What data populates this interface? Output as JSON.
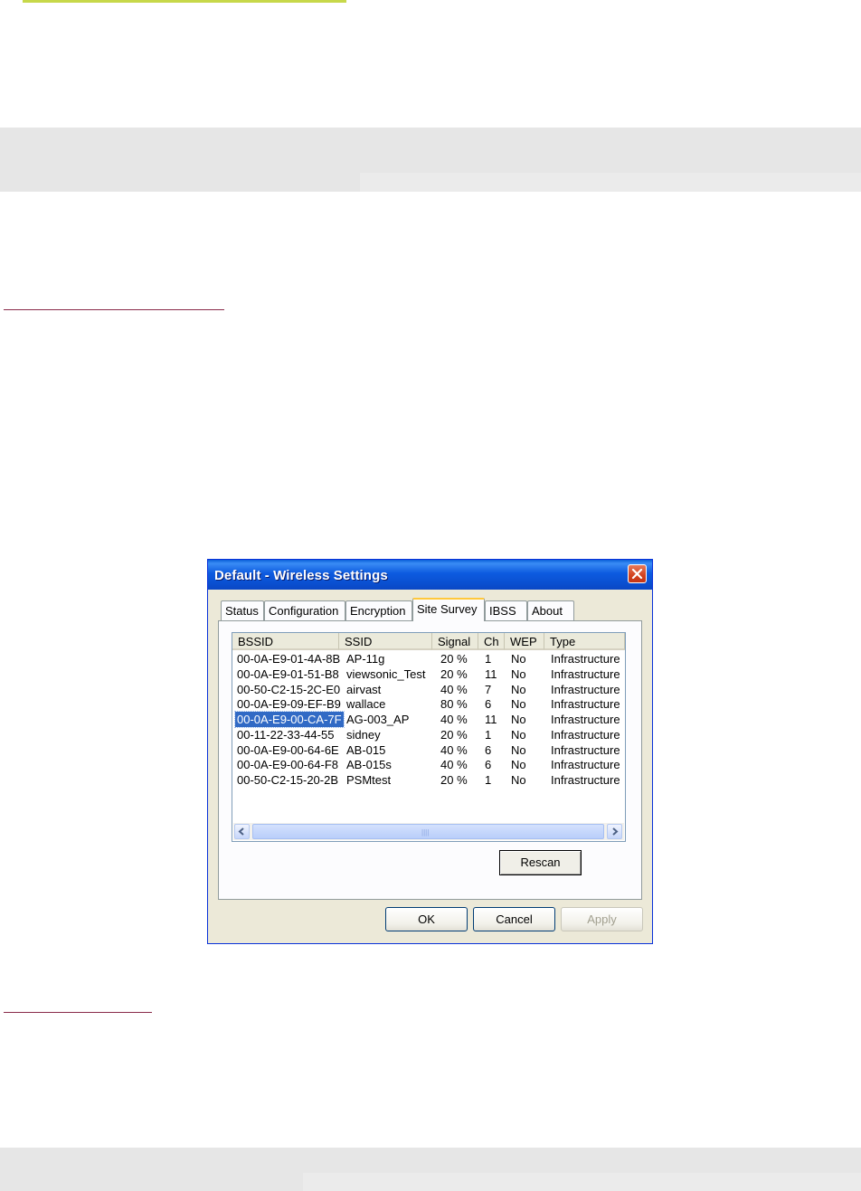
{
  "window": {
    "title": "Default - Wireless Settings"
  },
  "tabs": [
    "Status",
    "Configuration",
    "Encryption",
    "Site Survey",
    "IBSS",
    "About"
  ],
  "active_tab": "Site Survey",
  "columns": [
    "BSSID",
    "SSID",
    "Signal",
    "Ch",
    "WEP",
    "Type"
  ],
  "rows": [
    [
      "00-0A-E9-01-4A-8B",
      "AP-11g",
      "20 %",
      "1",
      "No",
      "Infrastructure"
    ],
    [
      "00-0A-E9-01-51-B8",
      "viewsonic_Test",
      "20 %",
      "11",
      "No",
      "Infrastructure"
    ],
    [
      "00-50-C2-15-2C-E0",
      "airvast",
      "40 %",
      "7",
      "No",
      "Infrastructure"
    ],
    [
      "00-0A-E9-09-EF-B9",
      "wallace",
      "80 %",
      "6",
      "No",
      "Infrastructure"
    ],
    [
      "00-0A-E9-00-CA-7F",
      "AG-003_AP",
      "40 %",
      "11",
      "No",
      "Infrastructure"
    ],
    [
      "00-11-22-33-44-55",
      "sidney",
      "20 %",
      "1",
      "No",
      "Infrastructure"
    ],
    [
      "00-0A-E9-00-64-6E",
      "AB-015",
      "40 %",
      "6",
      "No",
      "Infrastructure"
    ],
    [
      "00-0A-E9-00-64-F8",
      "AB-015s",
      "40 %",
      "6",
      "No",
      "Infrastructure"
    ],
    [
      "00-50-C2-15-20-2B",
      "PSMtest",
      "20 %",
      "1",
      "No",
      "Infrastructure"
    ]
  ],
  "selected_row": 4,
  "buttons": {
    "rescan": "Rescan",
    "ok": "OK",
    "cancel": "Cancel",
    "apply": "Apply"
  },
  "colors": {
    "title_bar": "#0a4fd0",
    "selection": "#316ac5",
    "page_rule_top": "#c7d84a",
    "page_rule": "#8a2b4a"
  }
}
